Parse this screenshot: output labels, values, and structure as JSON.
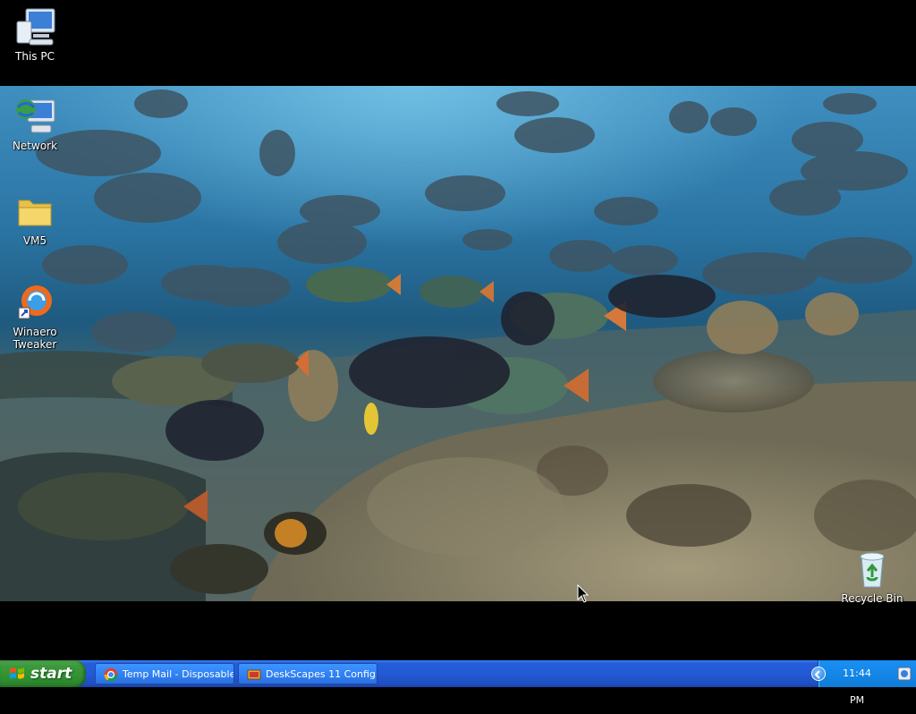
{
  "desktop": {
    "icons": [
      {
        "label": "This PC",
        "icon": "computer-icon"
      },
      {
        "label": "Network",
        "icon": "network-icon"
      },
      {
        "label": "VM5",
        "icon": "folder-icon"
      },
      {
        "label": "Winaero Tweaker",
        "icon": "winaero-tweaker-icon"
      },
      {
        "label": "Recycle Bin",
        "icon": "recycle-bin-icon"
      }
    ],
    "wallpaper": "underwater-reef-fish-scene"
  },
  "taskbar": {
    "start_label": "start",
    "tasks": [
      {
        "label": "Temp Mail - Disposable...",
        "icon": "chrome-icon"
      },
      {
        "label": "DeskScapes 11 Config...",
        "icon": "deskscapes-icon"
      }
    ],
    "clock": "11:44 PM"
  },
  "colors": {
    "taskbar_blue": "#245edb",
    "start_green": "#3c9a3c",
    "tray_blue": "#1589ea"
  }
}
